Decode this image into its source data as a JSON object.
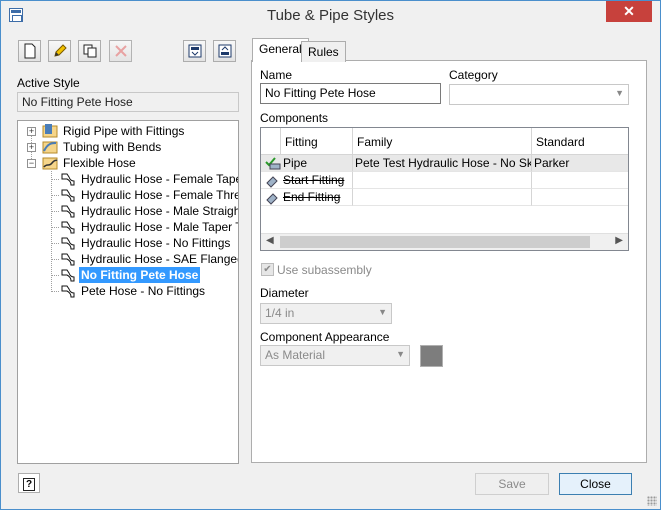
{
  "window": {
    "title": "Tube & Pipe Styles"
  },
  "left": {
    "active_style_label": "Active Style",
    "active_style_value": "No Fitting Pete Hose",
    "tree": {
      "categories": [
        {
          "label": "Rigid Pipe with Fittings",
          "expanded": false
        },
        {
          "label": "Tubing with Bends",
          "expanded": false
        },
        {
          "label": "Flexible Hose",
          "expanded": true
        }
      ],
      "styles": [
        "Hydraulic Hose - Female Taper Th",
        "Hydraulic Hose - Female Thread",
        "Hydraulic Hose - Male Straight Th",
        "Hydraulic Hose - Male Taper Thre",
        "Hydraulic Hose - No Fittings",
        "Hydraulic Hose - SAE Flanged Co",
        "No Fitting Pete Hose",
        "Pete Hose - No Fittings"
      ],
      "selected": "No Fitting Pete Hose"
    }
  },
  "tabs": {
    "general": "General",
    "rules": "Rules"
  },
  "general": {
    "name_label": "Name",
    "name_value": "No Fitting Pete Hose",
    "category_label": "Category",
    "category_value": "",
    "components_label": "Components",
    "columns": [
      "Fitting",
      "Family",
      "Standard"
    ],
    "rows": [
      {
        "fitting": "Pipe",
        "family": "Pete Test Hydraulic Hose - No Skive",
        "standard": "Parker"
      },
      {
        "fitting": "Start Fitting",
        "family": "",
        "standard": ""
      },
      {
        "fitting": "End Fitting",
        "family": "",
        "standard": ""
      }
    ],
    "use_subassembly_label": "Use subassembly",
    "use_subassembly_checked": true,
    "diameter_label": "Diameter",
    "diameter_value": "1/4 in",
    "appearance_label": "Component Appearance",
    "appearance_value": "As Material",
    "swatch_color": "#7d7d7d"
  },
  "buttons": {
    "save": "Save",
    "close": "Close",
    "help": "?"
  },
  "colors": {
    "selection": "#3399ff",
    "close_button": "#c7413c"
  }
}
